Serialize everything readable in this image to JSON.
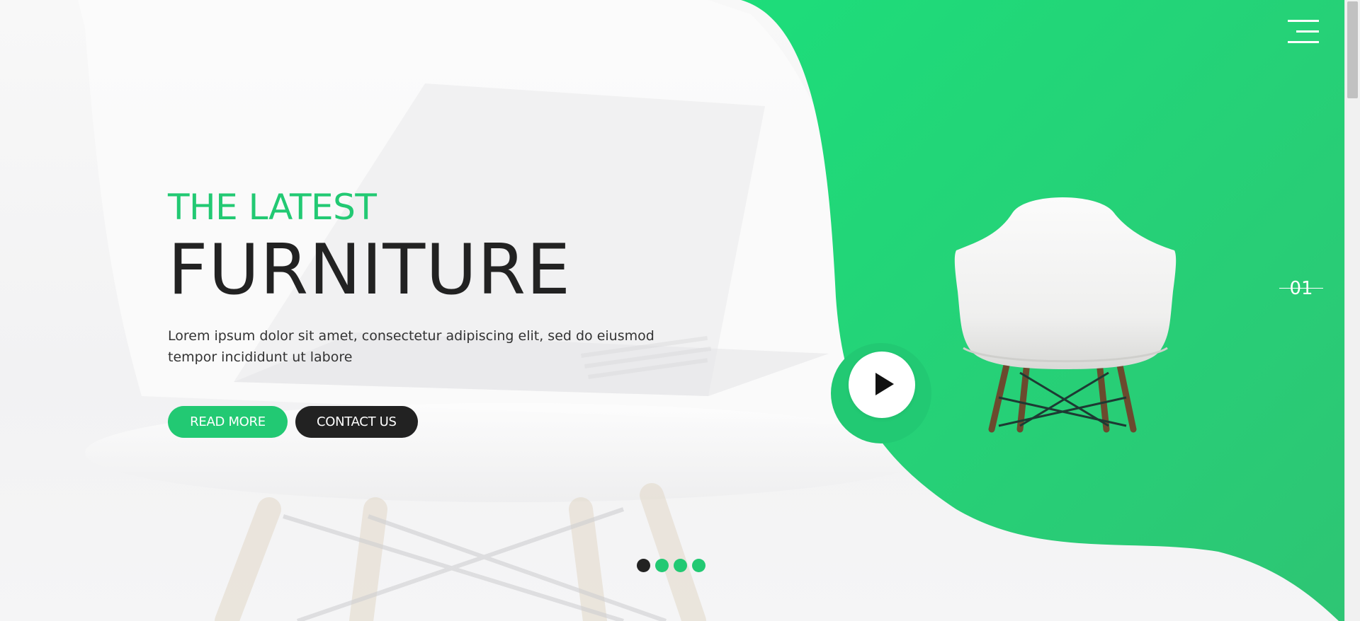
{
  "hero": {
    "eyebrow": "THE LATEST",
    "headline": "FURNITURE",
    "lead": "Lorem ipsum dolor sit amet, consectetur adipiscing elit, sed do eiusmod tempor incididunt ut labore",
    "read_more_label": "READ MORE",
    "contact_label": "CONTACT US"
  },
  "slider": {
    "current_number": "01",
    "dots_total": 4,
    "active_dot": 1
  },
  "icons": {
    "menu": "hamburger-menu-icon",
    "play": "play-icon"
  },
  "colors": {
    "accent": "#22c973",
    "dark": "#222222",
    "background": "#f5f5f6"
  }
}
